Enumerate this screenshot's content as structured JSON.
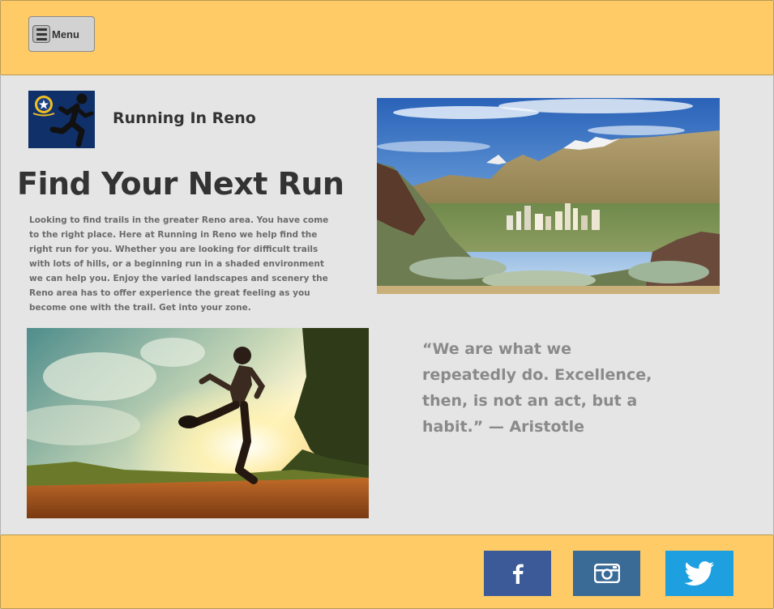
{
  "header": {
    "menu_label": "Menu",
    "menu_icon": "hamburger-icon",
    "background_color": "#fecb66"
  },
  "brand": {
    "site_name": "Running In Reno",
    "logo_icon": "nevada-flag-runner-logo"
  },
  "main": {
    "headline": "Find Your Next Run",
    "intro": "Looking to find trails in the greater Reno area. You have come to the right place. Here at Running in Reno we help find the right run for you. Whether you are looking for difficult trails with lots of hills, or a beginning run in a shaded environment we can help you. Enjoy the varied landscapes and scenery the Reno area has to offer experience the great feeling as you become one with the trail. Get into your zone.",
    "quote": "“We are what we repeatedly do. Excellence, then, is not an act, but a habit.” — Aristotle"
  },
  "images": {
    "reno_skyline": "reno-mountain-skyline-photo",
    "runner": "trail-runner-sunset-photo"
  },
  "footer": {
    "social": [
      {
        "name": "facebook",
        "icon": "facebook-icon",
        "color": "#3c5a98"
      },
      {
        "name": "instagram",
        "icon": "instagram-icon",
        "color": "#3a6a96"
      },
      {
        "name": "twitter",
        "icon": "twitter-icon",
        "color": "#1e9fe0"
      }
    ]
  }
}
